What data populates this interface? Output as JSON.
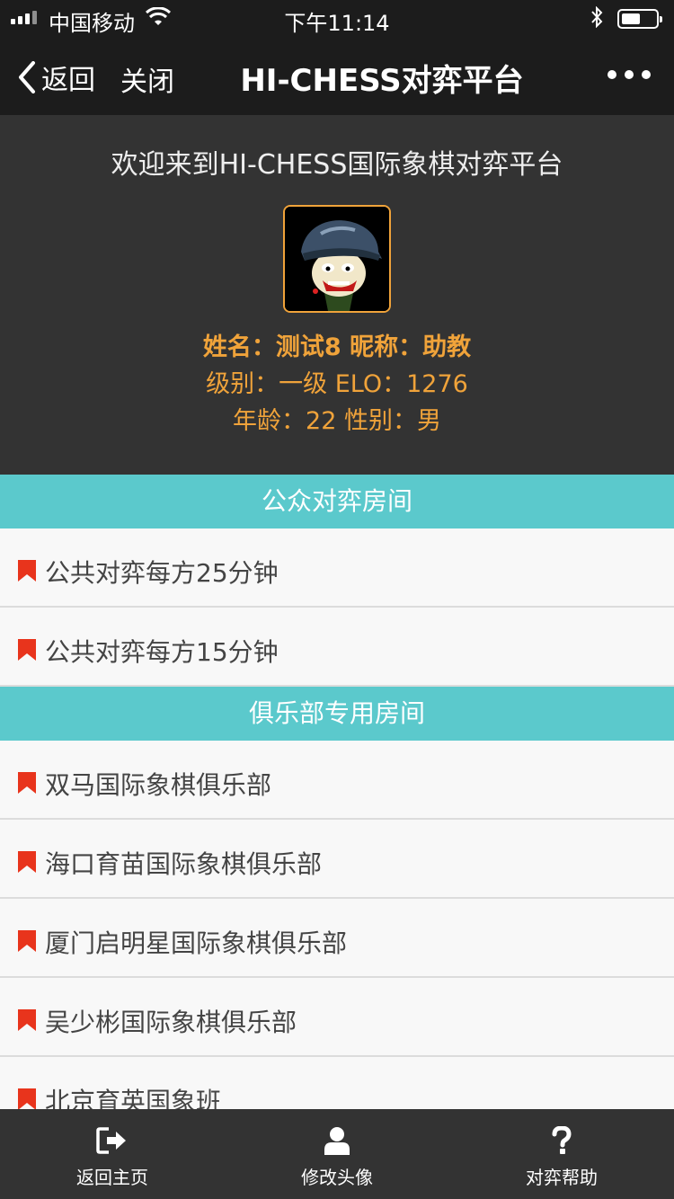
{
  "status_bar": {
    "carrier": "中国移动",
    "time": "下午11:14"
  },
  "nav": {
    "back_label": "返回",
    "close_label": "关闭",
    "title": "HI-CHESS对弈平台"
  },
  "profile": {
    "welcome": "欢迎来到HI-CHESS国际象棋对弈平台",
    "line1": "姓名：测试8 昵称：助教",
    "line2": "级别：一级 ELO：1276",
    "line3": "年龄：22 性别：男",
    "accent_color": "#f0a33a"
  },
  "public_rooms": {
    "header": "公众对弈房间",
    "items": [
      "公共对弈每方25分钟",
      "公共对弈每方15分钟"
    ]
  },
  "club_rooms": {
    "header": "俱乐部专用房间",
    "items": [
      "双马国际象棋俱乐部",
      "海口育苗国际象棋俱乐部",
      "厦门启明星国际象棋俱乐部",
      "吴少彬国际象棋俱乐部",
      "北京育英国象班"
    ]
  },
  "tab_bar": {
    "items": [
      {
        "label": "返回主页",
        "icon": "exit-icon"
      },
      {
        "label": "修改头像",
        "icon": "user-icon"
      },
      {
        "label": "对弈帮助",
        "icon": "question-icon"
      }
    ]
  },
  "colors": {
    "section_header": "#5bc9cc",
    "flag": "#e8341c",
    "dark_bg": "#333333"
  }
}
